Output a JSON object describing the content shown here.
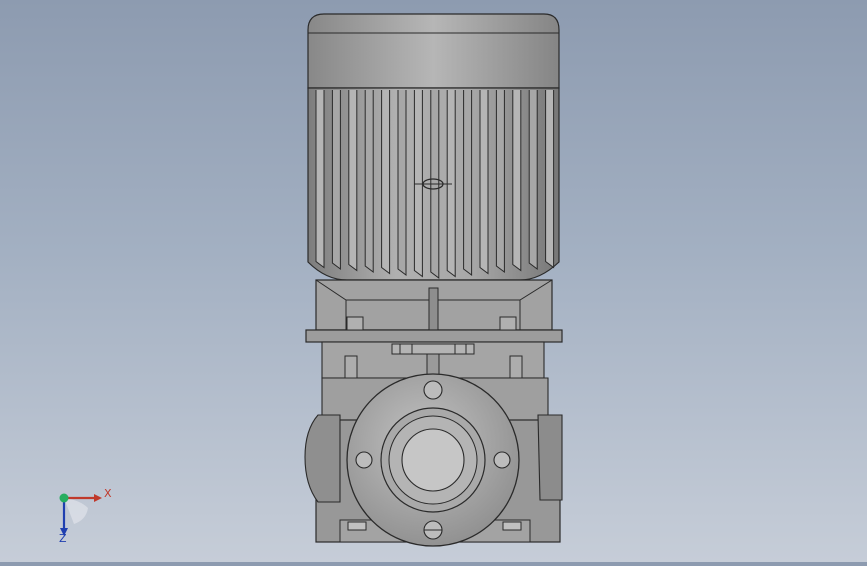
{
  "viewport": {
    "background_top": "#8d9bb0",
    "background_bottom": "#c6cdd8",
    "model_fill": "#9a9a9a",
    "model_edge": "#2a2a2a"
  },
  "triad": {
    "x_label": "X",
    "z_label": "Z",
    "x_color": "#c0392b",
    "y_color": "#27ae60",
    "z_color": "#1f3fb0"
  }
}
